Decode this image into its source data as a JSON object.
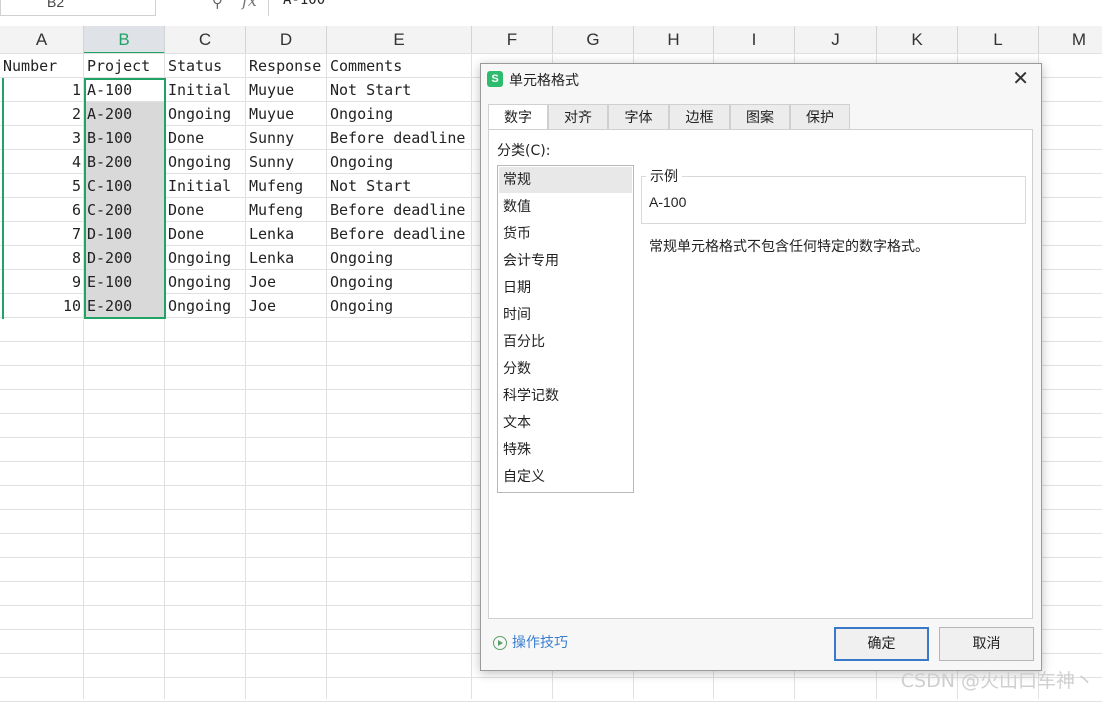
{
  "formula_bar": {
    "name_box": "B2",
    "fx_label": "fx",
    "formula": "A-100"
  },
  "columns": [
    "A",
    "B",
    "C",
    "D",
    "E",
    "F",
    "G",
    "H",
    "I",
    "J",
    "K",
    "L",
    "M"
  ],
  "selected_column": "B",
  "headers": {
    "number": "Number",
    "project": "Project",
    "status": "Status",
    "response": "Response",
    "comments": "Comments"
  },
  "rows": [
    {
      "number": "1",
      "project": "A-100",
      "status": "Initial",
      "response": "Muyue",
      "comments": "Not Start"
    },
    {
      "number": "2",
      "project": "A-200",
      "status": "Ongoing",
      "response": "Muyue",
      "comments": "Ongoing"
    },
    {
      "number": "3",
      "project": "B-100",
      "status": "Done",
      "response": "Sunny",
      "comments": "Before deadline"
    },
    {
      "number": "4",
      "project": "B-200",
      "status": "Ongoing",
      "response": "Sunny",
      "comments": "Ongoing"
    },
    {
      "number": "5",
      "project": "C-100",
      "status": "Initial",
      "response": "Mufeng",
      "comments": "Not Start"
    },
    {
      "number": "6",
      "project": "C-200",
      "status": "Done",
      "response": "Mufeng",
      "comments": "Before deadline"
    },
    {
      "number": "7",
      "project": "D-100",
      "status": "Done",
      "response": "Lenka",
      "comments": "Before deadline"
    },
    {
      "number": "8",
      "project": "D-200",
      "status": "Ongoing",
      "response": "Lenka",
      "comments": "Ongoing"
    },
    {
      "number": "9",
      "project": "E-100",
      "status": "Ongoing",
      "response": "Joe",
      "comments": "Ongoing"
    },
    {
      "number": "10",
      "project": "E-200",
      "status": "Ongoing",
      "response": "Joe",
      "comments": "Ongoing"
    }
  ],
  "dialog": {
    "logo": "S",
    "title": "单元格格式",
    "tabs": [
      "数字",
      "对齐",
      "字体",
      "边框",
      "图案",
      "保护"
    ],
    "active_tab": "数字",
    "category_label": "分类(C):",
    "categories": [
      "常规",
      "数值",
      "货币",
      "会计专用",
      "日期",
      "时间",
      "百分比",
      "分数",
      "科学记数",
      "文本",
      "特殊",
      "自定义"
    ],
    "selected_category": "常规",
    "example_legend": "示例",
    "example_value": "A-100",
    "description": "常规单元格格式不包含任何特定的数字格式。",
    "tips_label": "操作技巧",
    "ok_label": "确定",
    "cancel_label": "取消"
  },
  "watermark": "CSDN @火山口车神丶",
  "colors": {
    "accent": "#21a366",
    "link": "#3b7fd1",
    "primary_border": "#3a78c9",
    "logo": "#2dbb6e"
  }
}
